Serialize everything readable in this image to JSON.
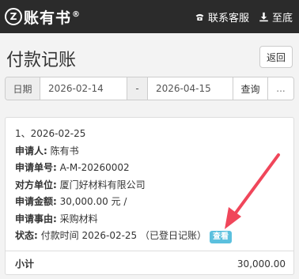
{
  "header": {
    "logo_mark": "Z",
    "app_name": "账有书",
    "reg_mark": "®",
    "support_label": "联系客服",
    "bottom_label": "至底"
  },
  "page": {
    "title": "付款记账",
    "back_label": "返回"
  },
  "filter": {
    "date_label": "日期",
    "start_date": "2026-02-14",
    "separator": "-",
    "end_date": "2026-04-15",
    "query_label": "查询",
    "more_label": "..."
  },
  "record": {
    "index_date": "1、2026-02-25",
    "applicant_label": "申请人:",
    "applicant": "陈有书",
    "apply_no_label": "申请单号:",
    "apply_no": "A-M-20260002",
    "counterparty_label": "对方单位:",
    "counterparty": "厦门好材料有限公司",
    "amount_label": "申请金额:",
    "amount": "30,000.00 元 /",
    "reason_label": "申请事由:",
    "reason": "采购材料",
    "status_label": "状态:",
    "status": "付款时间 2026-02-25 （已登日记账）",
    "view_label": "查看"
  },
  "subtotal": {
    "label": "小计",
    "value": "30,000.00"
  },
  "colors": {
    "topbar": "#2b2b2b",
    "badge": "#5bc0de",
    "arrow": "#f0465a"
  }
}
